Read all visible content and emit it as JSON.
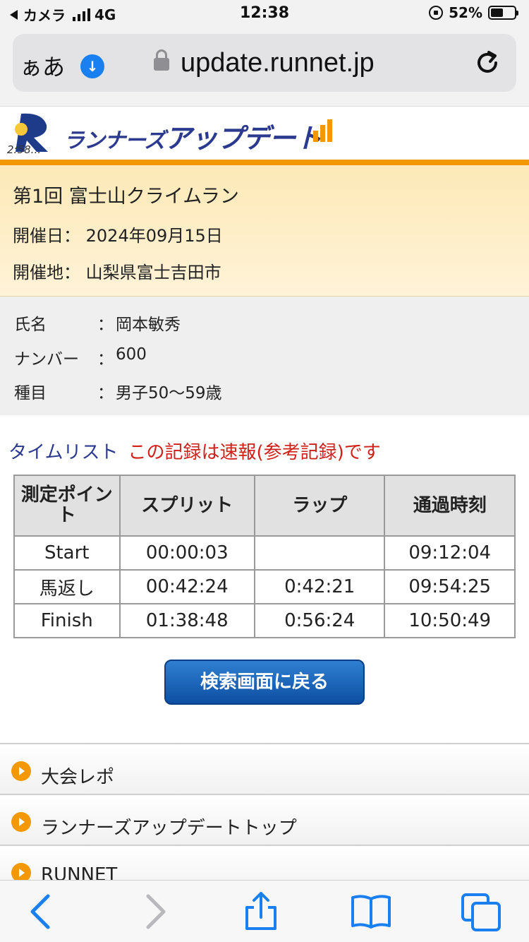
{
  "status_bar": {
    "back_app": "カメラ",
    "network": "4G",
    "time": "12:38",
    "battery_percent_text": "52%",
    "battery_level": 0.52
  },
  "browser": {
    "aa_label": "ぁあ",
    "url": "update.runnet.jp"
  },
  "logo": {
    "mark_text": "2:58...",
    "text_small": "ランナーズ",
    "text_big": "アップデート",
    "accent_color": "#f39800",
    "brand_color": "#2b3a8f"
  },
  "race": {
    "title": "第1回 富士山クライムラン",
    "date_label": "開催日：",
    "date_value": "2024年09月15日",
    "place_label": "開催地：",
    "place_value": "山梨県富士吉田市"
  },
  "runner": {
    "fields": [
      {
        "label": "氏名",
        "colon": "：",
        "value": "岡本敏秀"
      },
      {
        "label": "ナンバー",
        "colon": "：",
        "value": "600"
      },
      {
        "label": "種目",
        "colon": "：",
        "value": "男子50〜59歳"
      }
    ]
  },
  "time_list": {
    "title": "タイムリスト",
    "note": "この記録は速報(参考記録)です",
    "headers": [
      "測定ポイント",
      "スプリット",
      "ラップ",
      "通過時刻"
    ],
    "rows": [
      {
        "point": "Start",
        "split": "00:00:03",
        "lap": "",
        "passage": "09:12:04"
      },
      {
        "point": "馬返し",
        "split": "00:42:24",
        "lap": "0:42:21",
        "passage": "09:54:25"
      },
      {
        "point": "Finish",
        "split": "01:38:48",
        "lap": "0:56:24",
        "passage": "10:50:49"
      }
    ]
  },
  "back_button_label": "検索画面に戻る",
  "links": [
    {
      "label": "大会レポ"
    },
    {
      "label": "ランナーズアップデートトップ"
    },
    {
      "label": "RUNNET"
    }
  ],
  "toolbar": {
    "icons": [
      "back-icon",
      "forward-icon",
      "share-icon",
      "bookmarks-icon",
      "tabs-icon"
    ]
  }
}
